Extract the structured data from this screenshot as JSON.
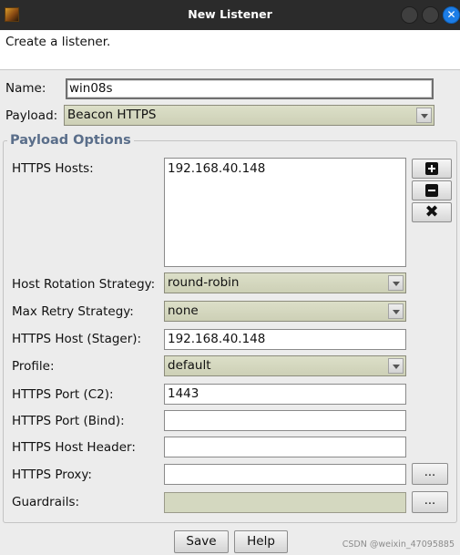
{
  "window": {
    "title": "New Listener",
    "close_glyph": "✕"
  },
  "description": "Create a listener.",
  "name": {
    "label": "Name:",
    "value": "win08s"
  },
  "payload": {
    "label": "Payload:",
    "value": "Beacon HTTPS"
  },
  "payload_options": {
    "title": "Payload Options",
    "https_hosts": {
      "label": "HTTPS Hosts:",
      "items": [
        "192.168.40.148"
      ]
    },
    "host_rotation": {
      "label": "Host Rotation Strategy:",
      "value": "round-robin"
    },
    "max_retry": {
      "label": "Max Retry Strategy:",
      "value": "none"
    },
    "host_stager": {
      "label": "HTTPS Host (Stager):",
      "value": "192.168.40.148"
    },
    "profile": {
      "label": "Profile:",
      "value": "default"
    },
    "port_c2": {
      "label": "HTTPS Port (C2):",
      "value": "1443"
    },
    "port_bind": {
      "label": "HTTPS Port (Bind):",
      "value": ""
    },
    "host_header": {
      "label": "HTTPS Host Header:",
      "value": ""
    },
    "proxy": {
      "label": "HTTPS Proxy:",
      "value": "",
      "button": "..."
    },
    "guardrails": {
      "label": "Guardrails:",
      "value": "",
      "button": "..."
    }
  },
  "buttons": {
    "save": "Save",
    "help": "Help"
  },
  "watermark": "CSDN @weixin_47095885",
  "icons": {
    "app": "cobalt-strike-icon",
    "add": "plus-square-icon",
    "remove": "minus-square-icon",
    "clear": "x-icon",
    "dropdown": "chevron-down-icon"
  },
  "colors": {
    "titlebar": "#2b2b2b",
    "close_button": "#1c7de6",
    "group_title": "#5a6e8a",
    "combo_bg": "#d4d8c0"
  }
}
